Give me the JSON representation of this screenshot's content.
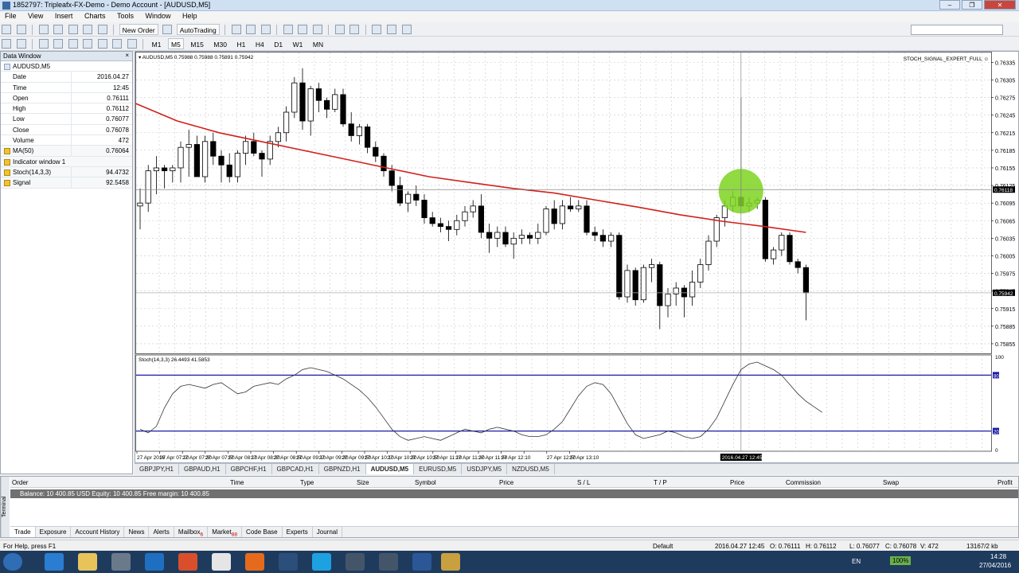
{
  "window": {
    "title": "1852797: Tripleafx-FX-Demo - Demo Account - [AUDUSD,M5]",
    "controls": [
      "–",
      "❐",
      "✕"
    ]
  },
  "menu": [
    "File",
    "View",
    "Insert",
    "Charts",
    "Tools",
    "Window",
    "Help"
  ],
  "toolbar": {
    "new_order": "New Order",
    "auto_trading": "AutoTrading"
  },
  "timeframes": [
    "M1",
    "M5",
    "M15",
    "M30",
    "H1",
    "H4",
    "D1",
    "W1",
    "MN"
  ],
  "data_window": {
    "title": "Data Window",
    "symbol": "AUDUSD,M5",
    "rows": [
      {
        "k": "Date",
        "v": "2016.04.27"
      },
      {
        "k": "Time",
        "v": "12:45"
      },
      {
        "k": "Open",
        "v": "0.76111"
      },
      {
        "k": "High",
        "v": "0.76112"
      },
      {
        "k": "Low",
        "v": "0.76077"
      },
      {
        "k": "Close",
        "v": "0.76078"
      },
      {
        "k": "Volume",
        "v": "472"
      },
      {
        "k": "MA(50)",
        "v": "0.76064",
        "group": true
      },
      {
        "k": "Indicator window 1",
        "v": "",
        "group": true
      },
      {
        "k": "Stoch(14,3,3)",
        "v": "94.4732",
        "group": true
      },
      {
        "k": "Signal",
        "v": "92.5458",
        "group": true
      }
    ]
  },
  "chart": {
    "header": "AUDUSD,M5  0.75988 0.75988 0.75891 0.75942",
    "indicator_label": "STOCH_SIGNAL_EXPERT_FULL",
    "price_ticks": [
      "0.76335",
      "0.76305",
      "0.76275",
      "0.76245",
      "0.76215",
      "0.76185",
      "0.76155",
      "0.76125",
      "0.76095",
      "0.76065",
      "0.76035",
      "0.76005",
      "0.75975",
      "0.75945",
      "0.75915",
      "0.75885",
      "0.75855"
    ],
    "current_price": "0.75942",
    "crosshair_price": "0.76118",
    "stoch_label": "Stoch(14,3,3) 26.4493 41.5853",
    "stoch_levels": [
      "80",
      "20"
    ],
    "stoch_ticks": [
      "100",
      "0"
    ],
    "time_ticks": [
      "27 Apr 2016",
      "27 Apr 07:10",
      "27 Apr 07:30",
      "27 Apr 07:50",
      "27 Apr 08:10",
      "27 Apr 08:30",
      "27 Apr 08:50",
      "27 Apr 09:10",
      "27 Apr 09:30",
      "27 Apr 09:50",
      "27 Apr 10:10",
      "27 Apr 10:30",
      "27 Apr 10:50",
      "27 Apr 11:10",
      "27 Apr 11:30",
      "27 Apr 11:50",
      "27 Apr 12:10",
      "",
      "27 Apr 12:50",
      "27 Apr 13:10"
    ],
    "crosshair_time": "2016.04.27 12:45",
    "ma_color": "#d0211c",
    "highlight_color": "#7ed321"
  },
  "chart_data": {
    "type": "candlestick",
    "symbol": "AUDUSD,M5",
    "ylim": [
      0.7584,
      0.76345
    ],
    "candles": [
      [
        0.7609,
        0.7612,
        0.7605,
        0.76095
      ],
      [
        0.76095,
        0.7616,
        0.7608,
        0.7615
      ],
      [
        0.7615,
        0.76175,
        0.7611,
        0.76155
      ],
      [
        0.76155,
        0.7616,
        0.7612,
        0.7615
      ],
      [
        0.7615,
        0.7616,
        0.7613,
        0.76155
      ],
      [
        0.76155,
        0.762,
        0.7613,
        0.7619
      ],
      [
        0.7619,
        0.7622,
        0.7614,
        0.76195
      ],
      [
        0.76195,
        0.7621,
        0.7614,
        0.7614
      ],
      [
        0.7614,
        0.7621,
        0.7613,
        0.762
      ],
      [
        0.762,
        0.76215,
        0.7616,
        0.76175
      ],
      [
        0.76175,
        0.76185,
        0.7613,
        0.7616
      ],
      [
        0.7616,
        0.7618,
        0.7613,
        0.7614
      ],
      [
        0.7614,
        0.76185,
        0.7613,
        0.7618
      ],
      [
        0.7618,
        0.7621,
        0.7616,
        0.762
      ],
      [
        0.762,
        0.76215,
        0.76175,
        0.7618
      ],
      [
        0.7618,
        0.76185,
        0.7614,
        0.7617
      ],
      [
        0.7617,
        0.7621,
        0.7616,
        0.762
      ],
      [
        0.762,
        0.76225,
        0.7619,
        0.76215
      ],
      [
        0.76215,
        0.7626,
        0.762,
        0.7625
      ],
      [
        0.7625,
        0.7631,
        0.7624,
        0.763
      ],
      [
        0.763,
        0.76325,
        0.7622,
        0.76235
      ],
      [
        0.76235,
        0.76295,
        0.7621,
        0.7629
      ],
      [
        0.7629,
        0.763,
        0.7625,
        0.7627
      ],
      [
        0.7627,
        0.76275,
        0.7624,
        0.76255
      ],
      [
        0.76255,
        0.7629,
        0.7625,
        0.7628
      ],
      [
        0.7628,
        0.7629,
        0.76225,
        0.7623
      ],
      [
        0.7623,
        0.7625,
        0.762,
        0.7621
      ],
      [
        0.7621,
        0.7623,
        0.76195,
        0.76225
      ],
      [
        0.76225,
        0.7623,
        0.7618,
        0.7619
      ],
      [
        0.7619,
        0.762,
        0.76165,
        0.76175
      ],
      [
        0.76175,
        0.7618,
        0.7614,
        0.7615
      ],
      [
        0.7615,
        0.7616,
        0.76115,
        0.76125
      ],
      [
        0.76125,
        0.7614,
        0.7609,
        0.76095
      ],
      [
        0.76095,
        0.76115,
        0.7608,
        0.7611
      ],
      [
        0.7611,
        0.76125,
        0.7609,
        0.761
      ],
      [
        0.761,
        0.7611,
        0.7606,
        0.7607
      ],
      [
        0.7607,
        0.7608,
        0.76055,
        0.7606
      ],
      [
        0.7606,
        0.7607,
        0.76045,
        0.76055
      ],
      [
        0.76055,
        0.76065,
        0.7603,
        0.7605
      ],
      [
        0.7605,
        0.76075,
        0.7604,
        0.76065
      ],
      [
        0.76065,
        0.7609,
        0.76055,
        0.7608
      ],
      [
        0.7608,
        0.761,
        0.7607,
        0.7609
      ],
      [
        0.7609,
        0.7611,
        0.76035,
        0.76045
      ],
      [
        0.76045,
        0.7606,
        0.7601,
        0.76035
      ],
      [
        0.76035,
        0.76055,
        0.7602,
        0.76045
      ],
      [
        0.76045,
        0.76055,
        0.7602,
        0.76025
      ],
      [
        0.76025,
        0.76045,
        0.76,
        0.76035
      ],
      [
        0.76035,
        0.7605,
        0.76025,
        0.7604
      ],
      [
        0.7604,
        0.76045,
        0.76025,
        0.76035
      ],
      [
        0.76035,
        0.7606,
        0.76025,
        0.76045
      ],
      [
        0.76045,
        0.7609,
        0.7604,
        0.76085
      ],
      [
        0.76085,
        0.761,
        0.7605,
        0.7606
      ],
      [
        0.7606,
        0.761,
        0.7605,
        0.7609
      ],
      [
        0.7609,
        0.76105,
        0.7608,
        0.76085
      ],
      [
        0.76085,
        0.761,
        0.7608,
        0.7609
      ],
      [
        0.7609,
        0.761,
        0.7604,
        0.76045
      ],
      [
        0.76045,
        0.76055,
        0.7603,
        0.7604
      ],
      [
        0.7604,
        0.7605,
        0.7602,
        0.7603
      ],
      [
        0.7603,
        0.76045,
        0.7602,
        0.7604
      ],
      [
        0.7604,
        0.76045,
        0.7593,
        0.75935
      ],
      [
        0.75935,
        0.7599,
        0.75925,
        0.7598
      ],
      [
        0.7598,
        0.75985,
        0.7592,
        0.7593
      ],
      [
        0.7593,
        0.7599,
        0.75925,
        0.75985
      ],
      [
        0.75985,
        0.76,
        0.7596,
        0.7599
      ],
      [
        0.7599,
        0.75995,
        0.7588,
        0.7592
      ],
      [
        0.7592,
        0.7595,
        0.759,
        0.7594
      ],
      [
        0.7594,
        0.7596,
        0.7592,
        0.7595
      ],
      [
        0.7595,
        0.75955,
        0.759,
        0.75935
      ],
      [
        0.75935,
        0.7598,
        0.7592,
        0.7596
      ],
      [
        0.7596,
        0.76,
        0.7595,
        0.7599
      ],
      [
        0.7599,
        0.7604,
        0.7598,
        0.7603
      ],
      [
        0.7603,
        0.76075,
        0.7602,
        0.7607
      ],
      [
        0.7607,
        0.761,
        0.76055,
        0.7609
      ],
      [
        0.7609,
        0.76115,
        0.7608,
        0.76105
      ],
      [
        0.76105,
        0.76275,
        0.7609,
        0.7609
      ],
      [
        0.7609,
        0.76105,
        0.7608,
        0.76095
      ],
      [
        0.76095,
        0.76105,
        0.76085,
        0.761
      ],
      [
        0.761,
        0.76105,
        0.75995,
        0.76
      ],
      [
        0.76,
        0.7602,
        0.7599,
        0.76015
      ],
      [
        0.76015,
        0.76045,
        0.76005,
        0.7604
      ],
      [
        0.7604,
        0.76045,
        0.7599,
        0.75995
      ],
      [
        0.75995,
        0.76,
        0.75975,
        0.75985
      ],
      [
        0.75985,
        0.7599,
        0.75895,
        0.75942
      ]
    ],
    "stoch": [
      22,
      18,
      25,
      45,
      60,
      68,
      70,
      68,
      66,
      70,
      72,
      66,
      60,
      62,
      68,
      70,
      72,
      70,
      76,
      80,
      86,
      88,
      86,
      84,
      80,
      76,
      70,
      64,
      56,
      46,
      34,
      22,
      14,
      10,
      12,
      14,
      12,
      10,
      14,
      18,
      22,
      20,
      18,
      22,
      24,
      22,
      20,
      16,
      14,
      14,
      16,
      22,
      30,
      44,
      58,
      68,
      72,
      70,
      60,
      44,
      28,
      16,
      12,
      14,
      16,
      20,
      18,
      14,
      12,
      14,
      22,
      34,
      52,
      70,
      86,
      92,
      94,
      90,
      86,
      80,
      70,
      60,
      52,
      46,
      40
    ],
    "ma": [
      0.76265,
      0.76235,
      0.76215,
      0.762,
      0.76185,
      0.7617,
      0.76155,
      0.7614,
      0.7613,
      0.7612,
      0.76112,
      0.761,
      0.76088,
      0.76075,
      0.76064,
      0.76055,
      0.76045
    ]
  }
}
